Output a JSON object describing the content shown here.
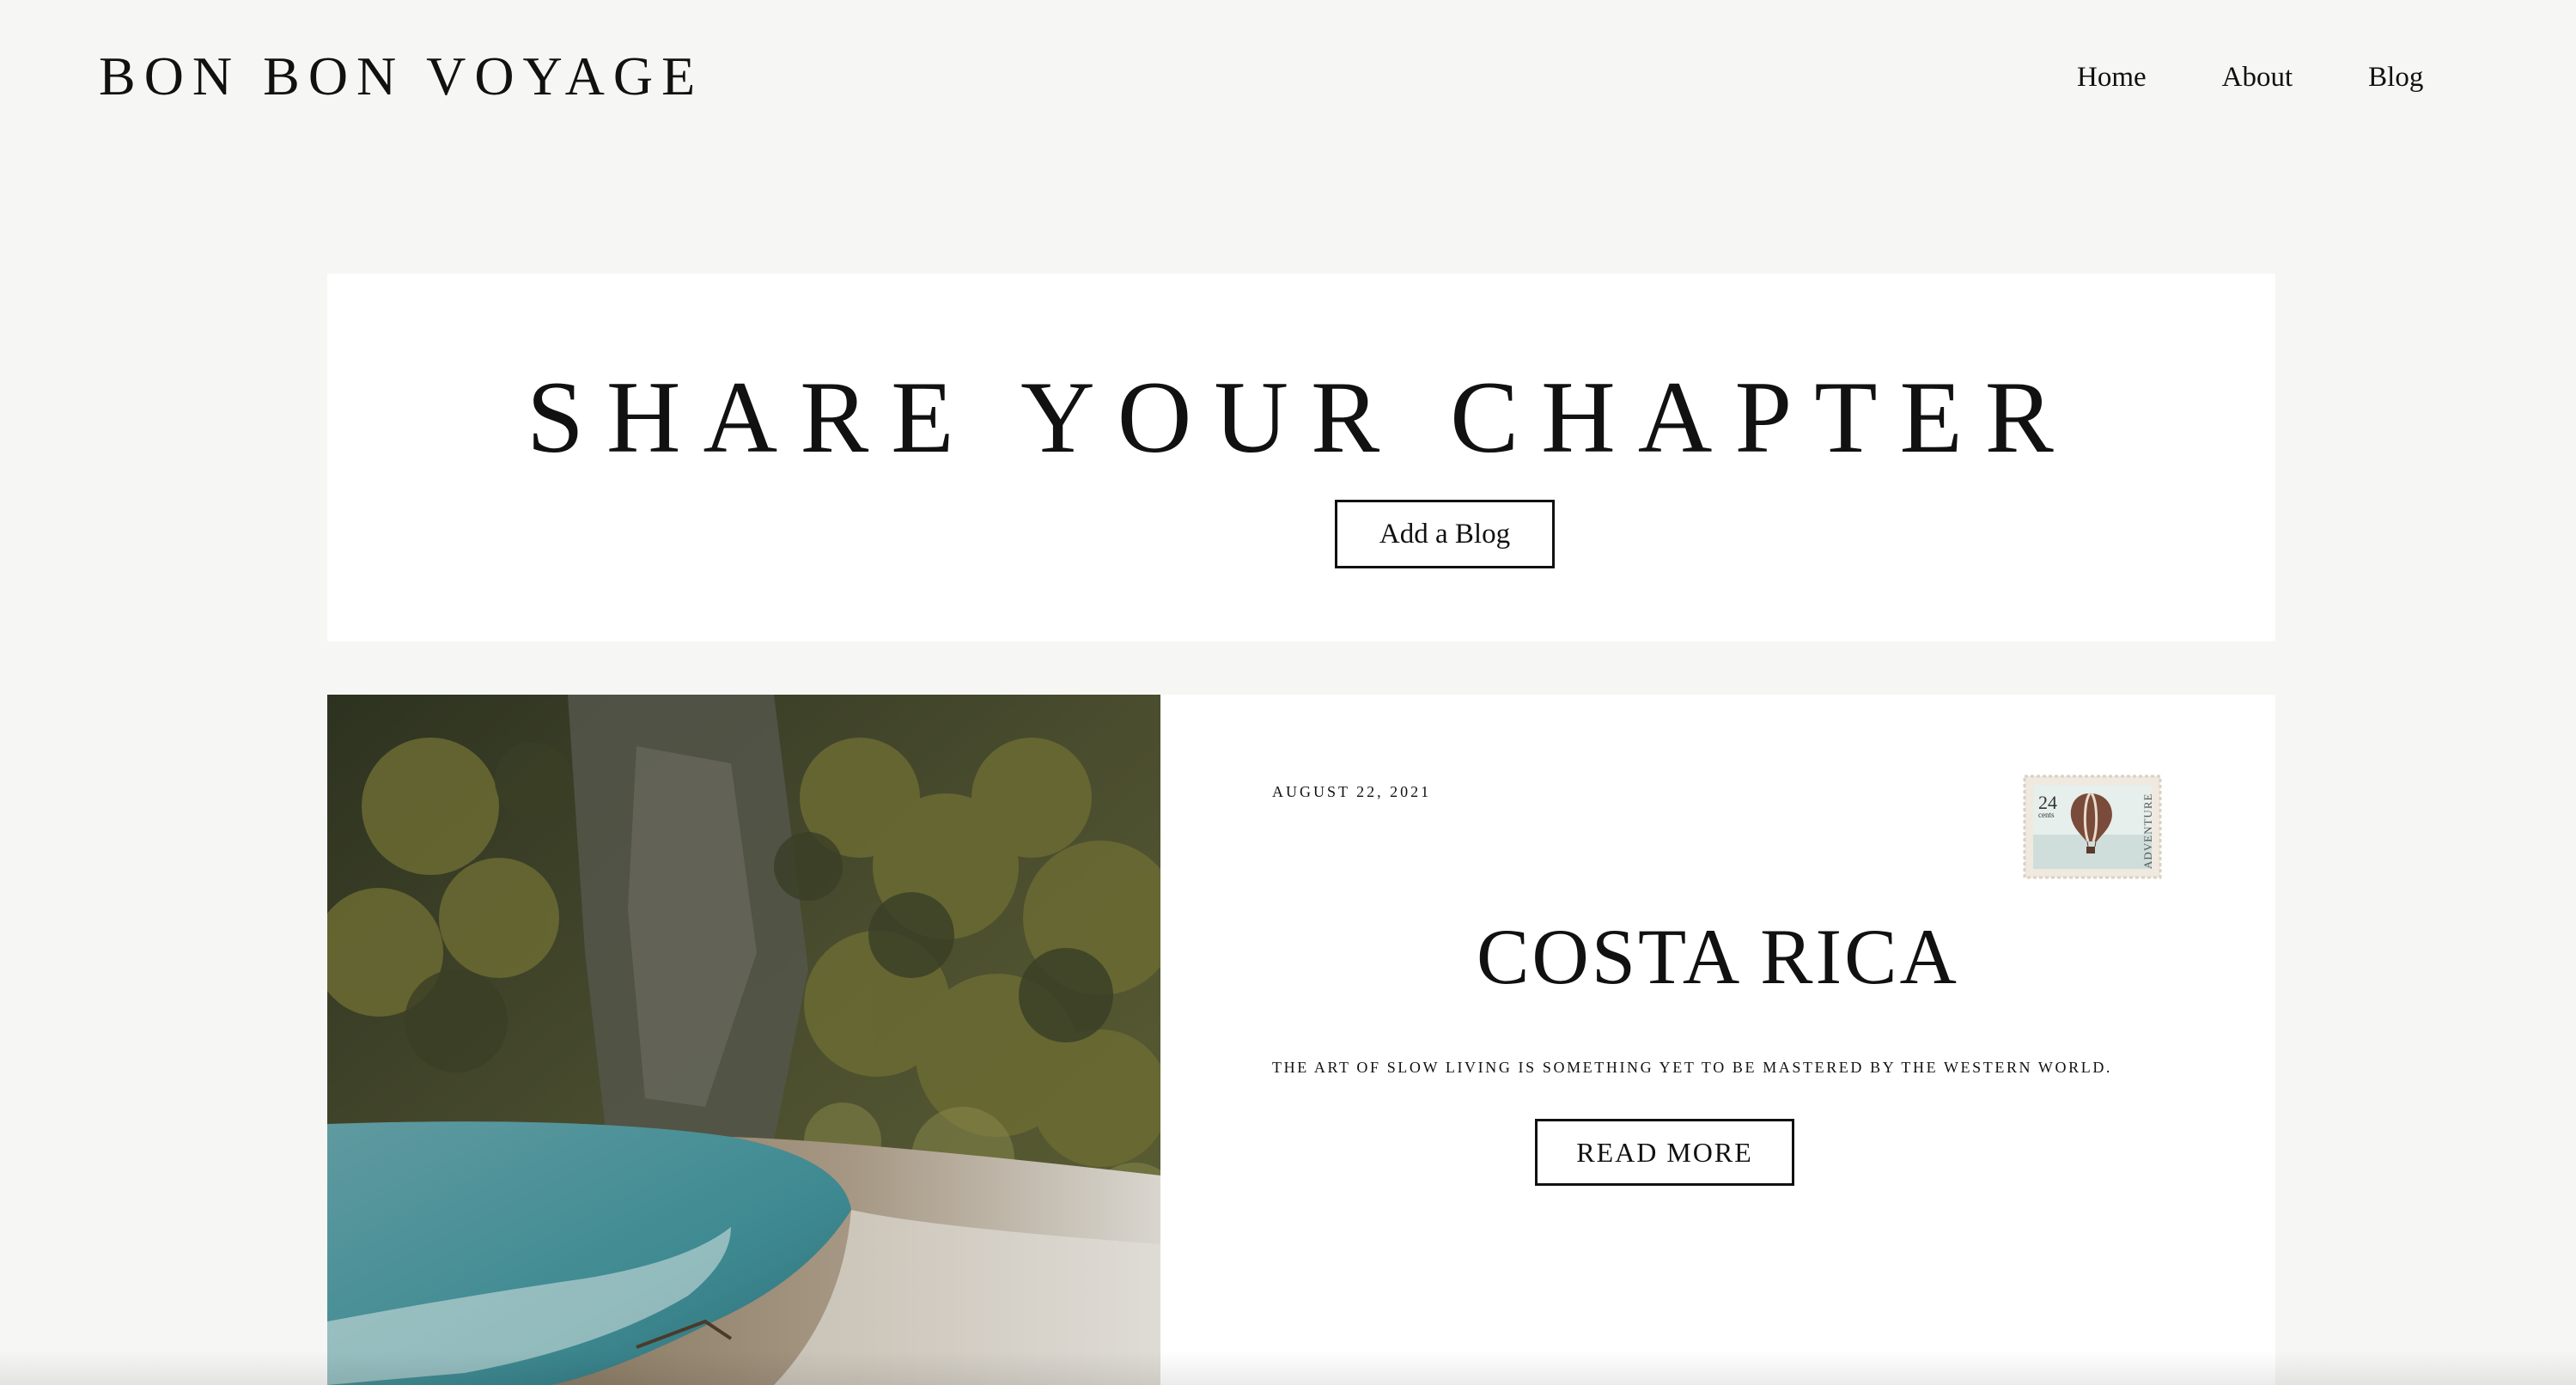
{
  "header": {
    "brand": "BON BON VOYAGE",
    "nav": [
      {
        "label": "Home"
      },
      {
        "label": "About"
      },
      {
        "label": "Blog"
      }
    ]
  },
  "share": {
    "title": "SHARE YOUR CHAPTER",
    "button_label": "Add a Blog"
  },
  "post": {
    "date": "AUGUST 22, 2021",
    "title": "COSTA RICA",
    "excerpt": "THE ART OF SLOW LIVING IS SOMETHING YET TO BE MASTERED BY THE WESTERN WORLD.",
    "read_more_label": "READ MORE",
    "image": "beach-cliff-photo",
    "stamp": {
      "value": "24",
      "unit": "cents",
      "caption": "ADVENTURE",
      "icon": "hot-air-balloon-icon"
    }
  },
  "colors": {
    "page_background": "#f6f6f4",
    "panel_background": "#ffffff",
    "text": "#111111"
  }
}
